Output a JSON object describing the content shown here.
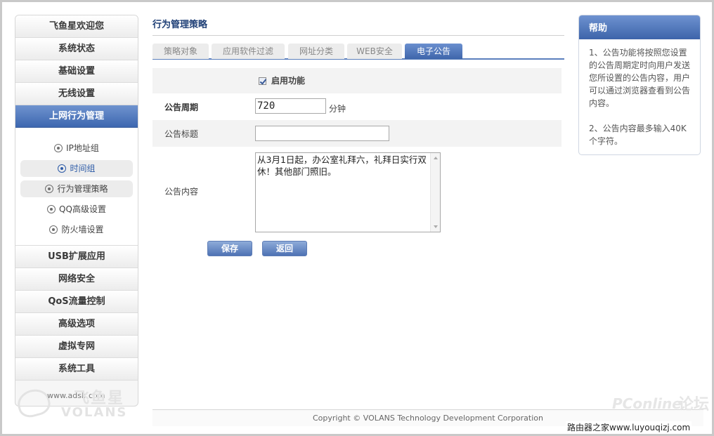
{
  "sidebar": {
    "top_items": [
      "飞鱼星欢迎您",
      "系统状态",
      "基础设置",
      "无线设置"
    ],
    "active_item": "上网行为管理",
    "sub_items": [
      "IP地址组",
      "时间组",
      "行为管理策略",
      "QQ高级设置",
      "防火墙设置"
    ],
    "bottom_items": [
      "USB扩展应用",
      "网络安全",
      "QoS流量控制",
      "高级选项",
      "虚拟专网",
      "系统工具"
    ],
    "logo": {
      "site": "www.adslr.com",
      "brand_cn": "飞鱼星",
      "brand_en": "VOLANS"
    }
  },
  "main": {
    "title": "行为管理策略",
    "tabs": [
      "策略对象",
      "应用软件过滤",
      "网址分类",
      "WEB安全",
      "电子公告"
    ],
    "active_tab": "电子公告",
    "form": {
      "enable_label": "启用功能",
      "enable_checked": true,
      "period_label": "公告周期",
      "period_value": "720",
      "period_unit": "分钟",
      "title_label": "公告标题",
      "title_value": "",
      "content_label": "公告内容",
      "content_value": "从3月1日起，办公室礼拜六，礼拜日实行双休！其他部门照旧。"
    },
    "buttons": {
      "save": "保存",
      "back": "返回"
    }
  },
  "help": {
    "title": "帮助",
    "paragraphs": [
      "1、公告功能将按照您设置的公告周期定时向用户发送您所设置的公告内容，用户可以通过浏览器查看到公告内容。",
      "2、公告内容最多输入40K个字符。"
    ]
  },
  "footer": {
    "copyright": "Copyright © VOLANS Technology Development Corporation"
  },
  "watermarks": {
    "pconline": "PConline",
    "forum": "论坛",
    "site": "路由器之家www.luyouqizj.com"
  },
  "colors": {
    "accent": "#3d67b0",
    "tab_active": "#4f74b8",
    "title": "#1e3f76"
  }
}
